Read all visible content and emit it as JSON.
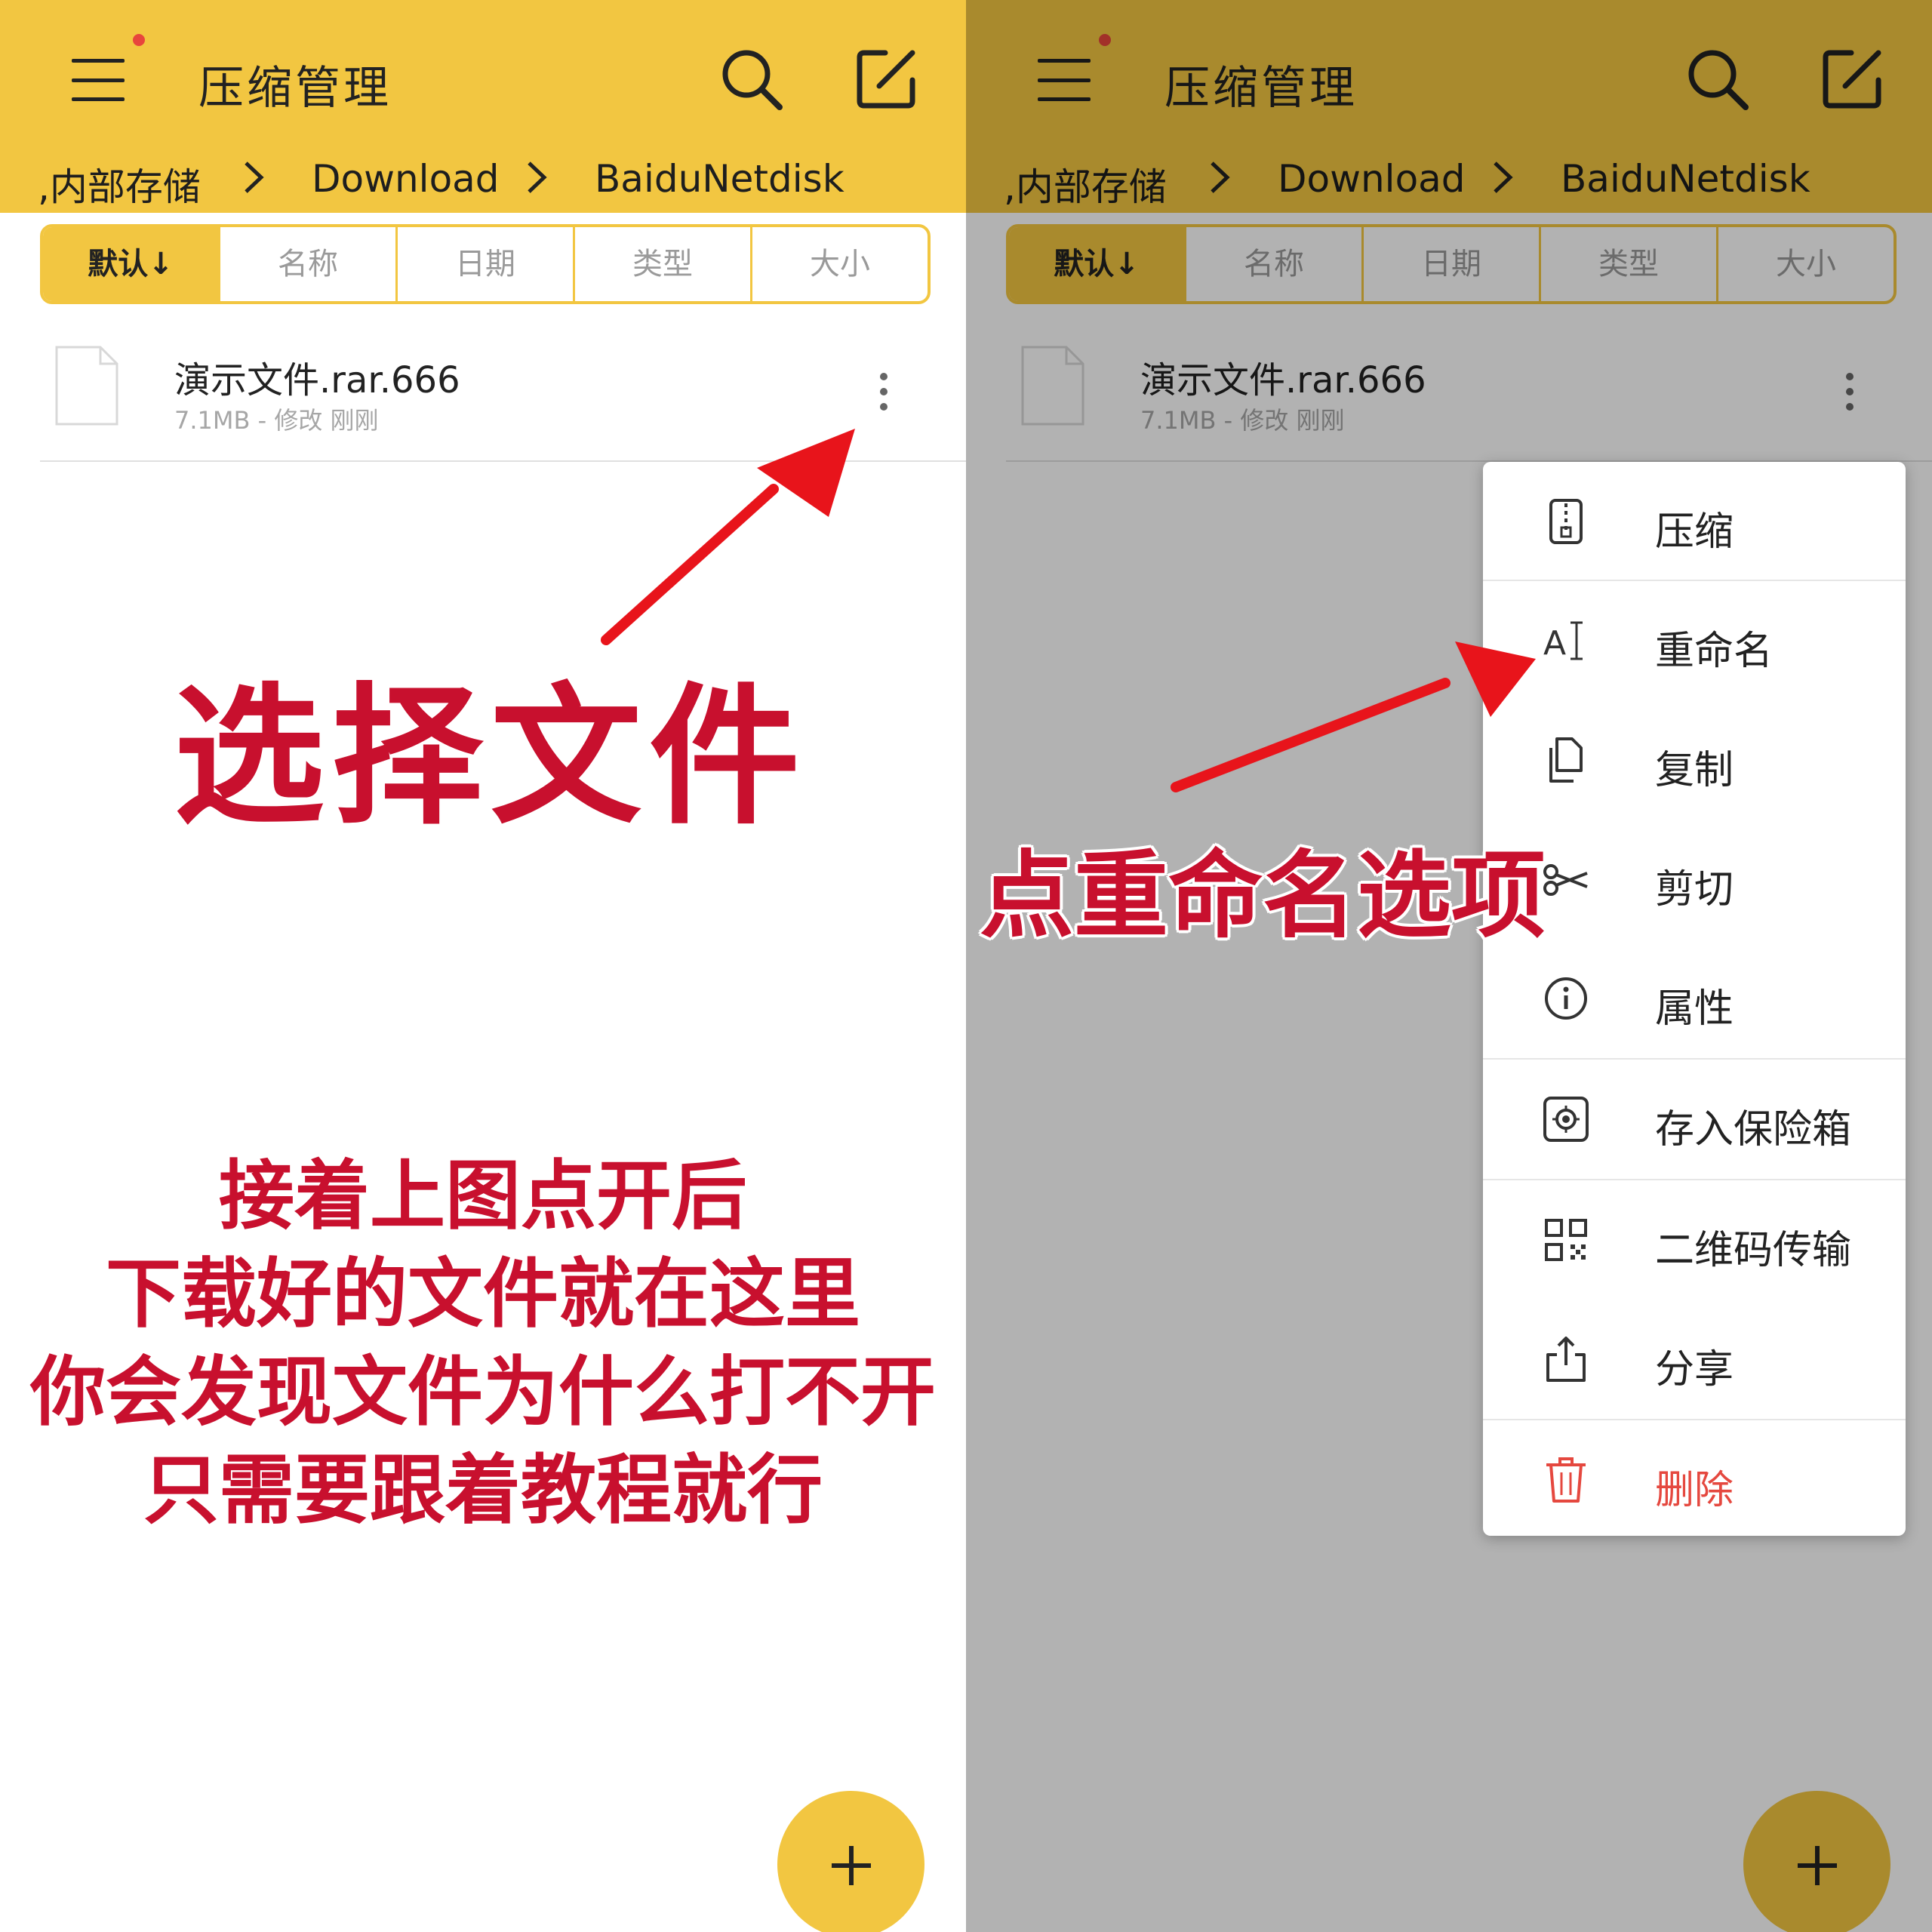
{
  "app": {
    "title": "压缩管理"
  },
  "breadcrumb": {
    "root": ",内部存储",
    "folder1": "Download",
    "folder2": "BaiduNetdisk"
  },
  "sort": {
    "tabs": [
      "默认↓",
      "名称",
      "日期",
      "类型",
      "大小"
    ],
    "active": "默认↓"
  },
  "file": {
    "name": "演示文件.rar.666",
    "meta": "7.1MB - 修改 刚刚"
  },
  "fab": {
    "label": "+"
  },
  "context_menu": {
    "items": [
      {
        "label": "压缩",
        "icon": "zip-icon"
      },
      {
        "label": "重命名",
        "icon": "rename-icon"
      },
      {
        "label": "复制",
        "icon": "copy-icon"
      },
      {
        "label": "剪切",
        "icon": "scissors-icon"
      },
      {
        "label": "属性",
        "icon": "info-icon"
      },
      {
        "label": "存入保险箱",
        "icon": "safe-icon"
      },
      {
        "label": "二维码传输",
        "icon": "qr-code-icon"
      },
      {
        "label": "分享",
        "icon": "share-icon"
      },
      {
        "label": "删除",
        "icon": "trash-icon"
      }
    ]
  },
  "annotations": {
    "select_file": "选择文件",
    "tap_rename": "点重命名选项",
    "description": [
      "接着上图点开后",
      "下载好的文件就在这里",
      "你会发现文件为什么打不开",
      "只需要跟着教程就行"
    ]
  },
  "colors": {
    "accent": "#F2C641",
    "annotation": "#C8102E",
    "danger": "#E5483F",
    "arrow": "#E8141B"
  }
}
